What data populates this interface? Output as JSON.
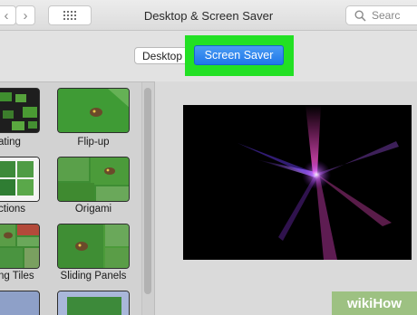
{
  "window": {
    "title": "Desktop & Screen Saver"
  },
  "toolbar": {
    "back_symbol": "‹",
    "forward_symbol": "›",
    "grid_icon": "grid-icon"
  },
  "search": {
    "placeholder": "Searc"
  },
  "tabs": {
    "desktop": "Desktop",
    "screen_saver": "Screen Saver",
    "selected": "Screen Saver",
    "highlight_color": "#22e024"
  },
  "screensavers": [
    {
      "label": "ating"
    },
    {
      "label": "Flip-up"
    },
    {
      "label": "ctions"
    },
    {
      "label": "Origami"
    },
    {
      "label": "ng Tiles"
    },
    {
      "label": "Sliding Panels"
    }
  ],
  "preview": {
    "name": "screen-saver-preview",
    "style": "dark light streaks"
  },
  "watermark": {
    "text": "wikiHow"
  },
  "colors": {
    "accent": "#1f77e9",
    "highlight": "#22e024",
    "preview_bg": "#000000"
  }
}
